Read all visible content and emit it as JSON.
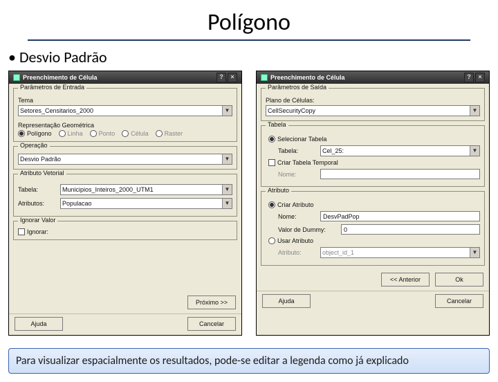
{
  "slide": {
    "title": "Polígono",
    "bullet": "Desvio Padrão",
    "footer": "Para visualizar espacialmente os resultados, pode-se editar a legenda como já explicado"
  },
  "dialog1": {
    "title": "Preenchimento de Célula",
    "help": "?",
    "close": "×",
    "grp_entrada": "Parâmetros de Entrada",
    "tema_label": "Tema",
    "tema_value": "Setores_Censitarios_2000",
    "rep_label": "Representação Geométrica",
    "rep_poligono": "Polígono",
    "rep_linha": "Linha",
    "rep_ponto": "Ponto",
    "rep_celula": "Célula",
    "rep_raster": "Raster",
    "grp_operacao": "Operação",
    "operacao_value": "Desvio Padrão",
    "grp_atributo": "Atributo Vetorial",
    "tabela_label": "Tabela:",
    "tabela_value": "Municipios_Inteiros_2000_UTM1",
    "atributos_label": "Atributos:",
    "atributos_value": "Populacao",
    "grp_ignorar": "Ignorar Valor",
    "ignorar_check": "Ignorar:",
    "btn_proximo": "Próximo >>",
    "btn_ajuda": "Ajuda",
    "btn_cancelar": "Cancelar"
  },
  "dialog2": {
    "title": "Preenchimento de Célula",
    "help": "?",
    "close": "×",
    "grp_saida": "Parâmetros de Saída",
    "plano_label": "Plano de Células:",
    "plano_value": "CellSecurityCopy",
    "grp_tabela": "Tabela",
    "seltab_radio": "Selecionar Tabela",
    "tabela_label": "Tabela:",
    "tabela_value": "Cel_25:",
    "criar_temporal": "Criar Tabela Temporal",
    "nome_label": "Nome:",
    "grp_atributo": "Atributo",
    "criar_atributo": "Criar Atributo",
    "nome_attr_label": "Nome:",
    "nome_attr_value": "DesvPadPop",
    "dummy_label": "Valor de Dummy:",
    "dummy_value": "0",
    "usar_atributo": "Usar Atributo",
    "atributo_label": "Atributo:",
    "atributo_value": "object_id_1",
    "btn_anterior": "<< Anterior",
    "btn_ok": "Ok",
    "btn_ajuda": "Ajuda",
    "btn_cancelar": "Cancelar"
  }
}
